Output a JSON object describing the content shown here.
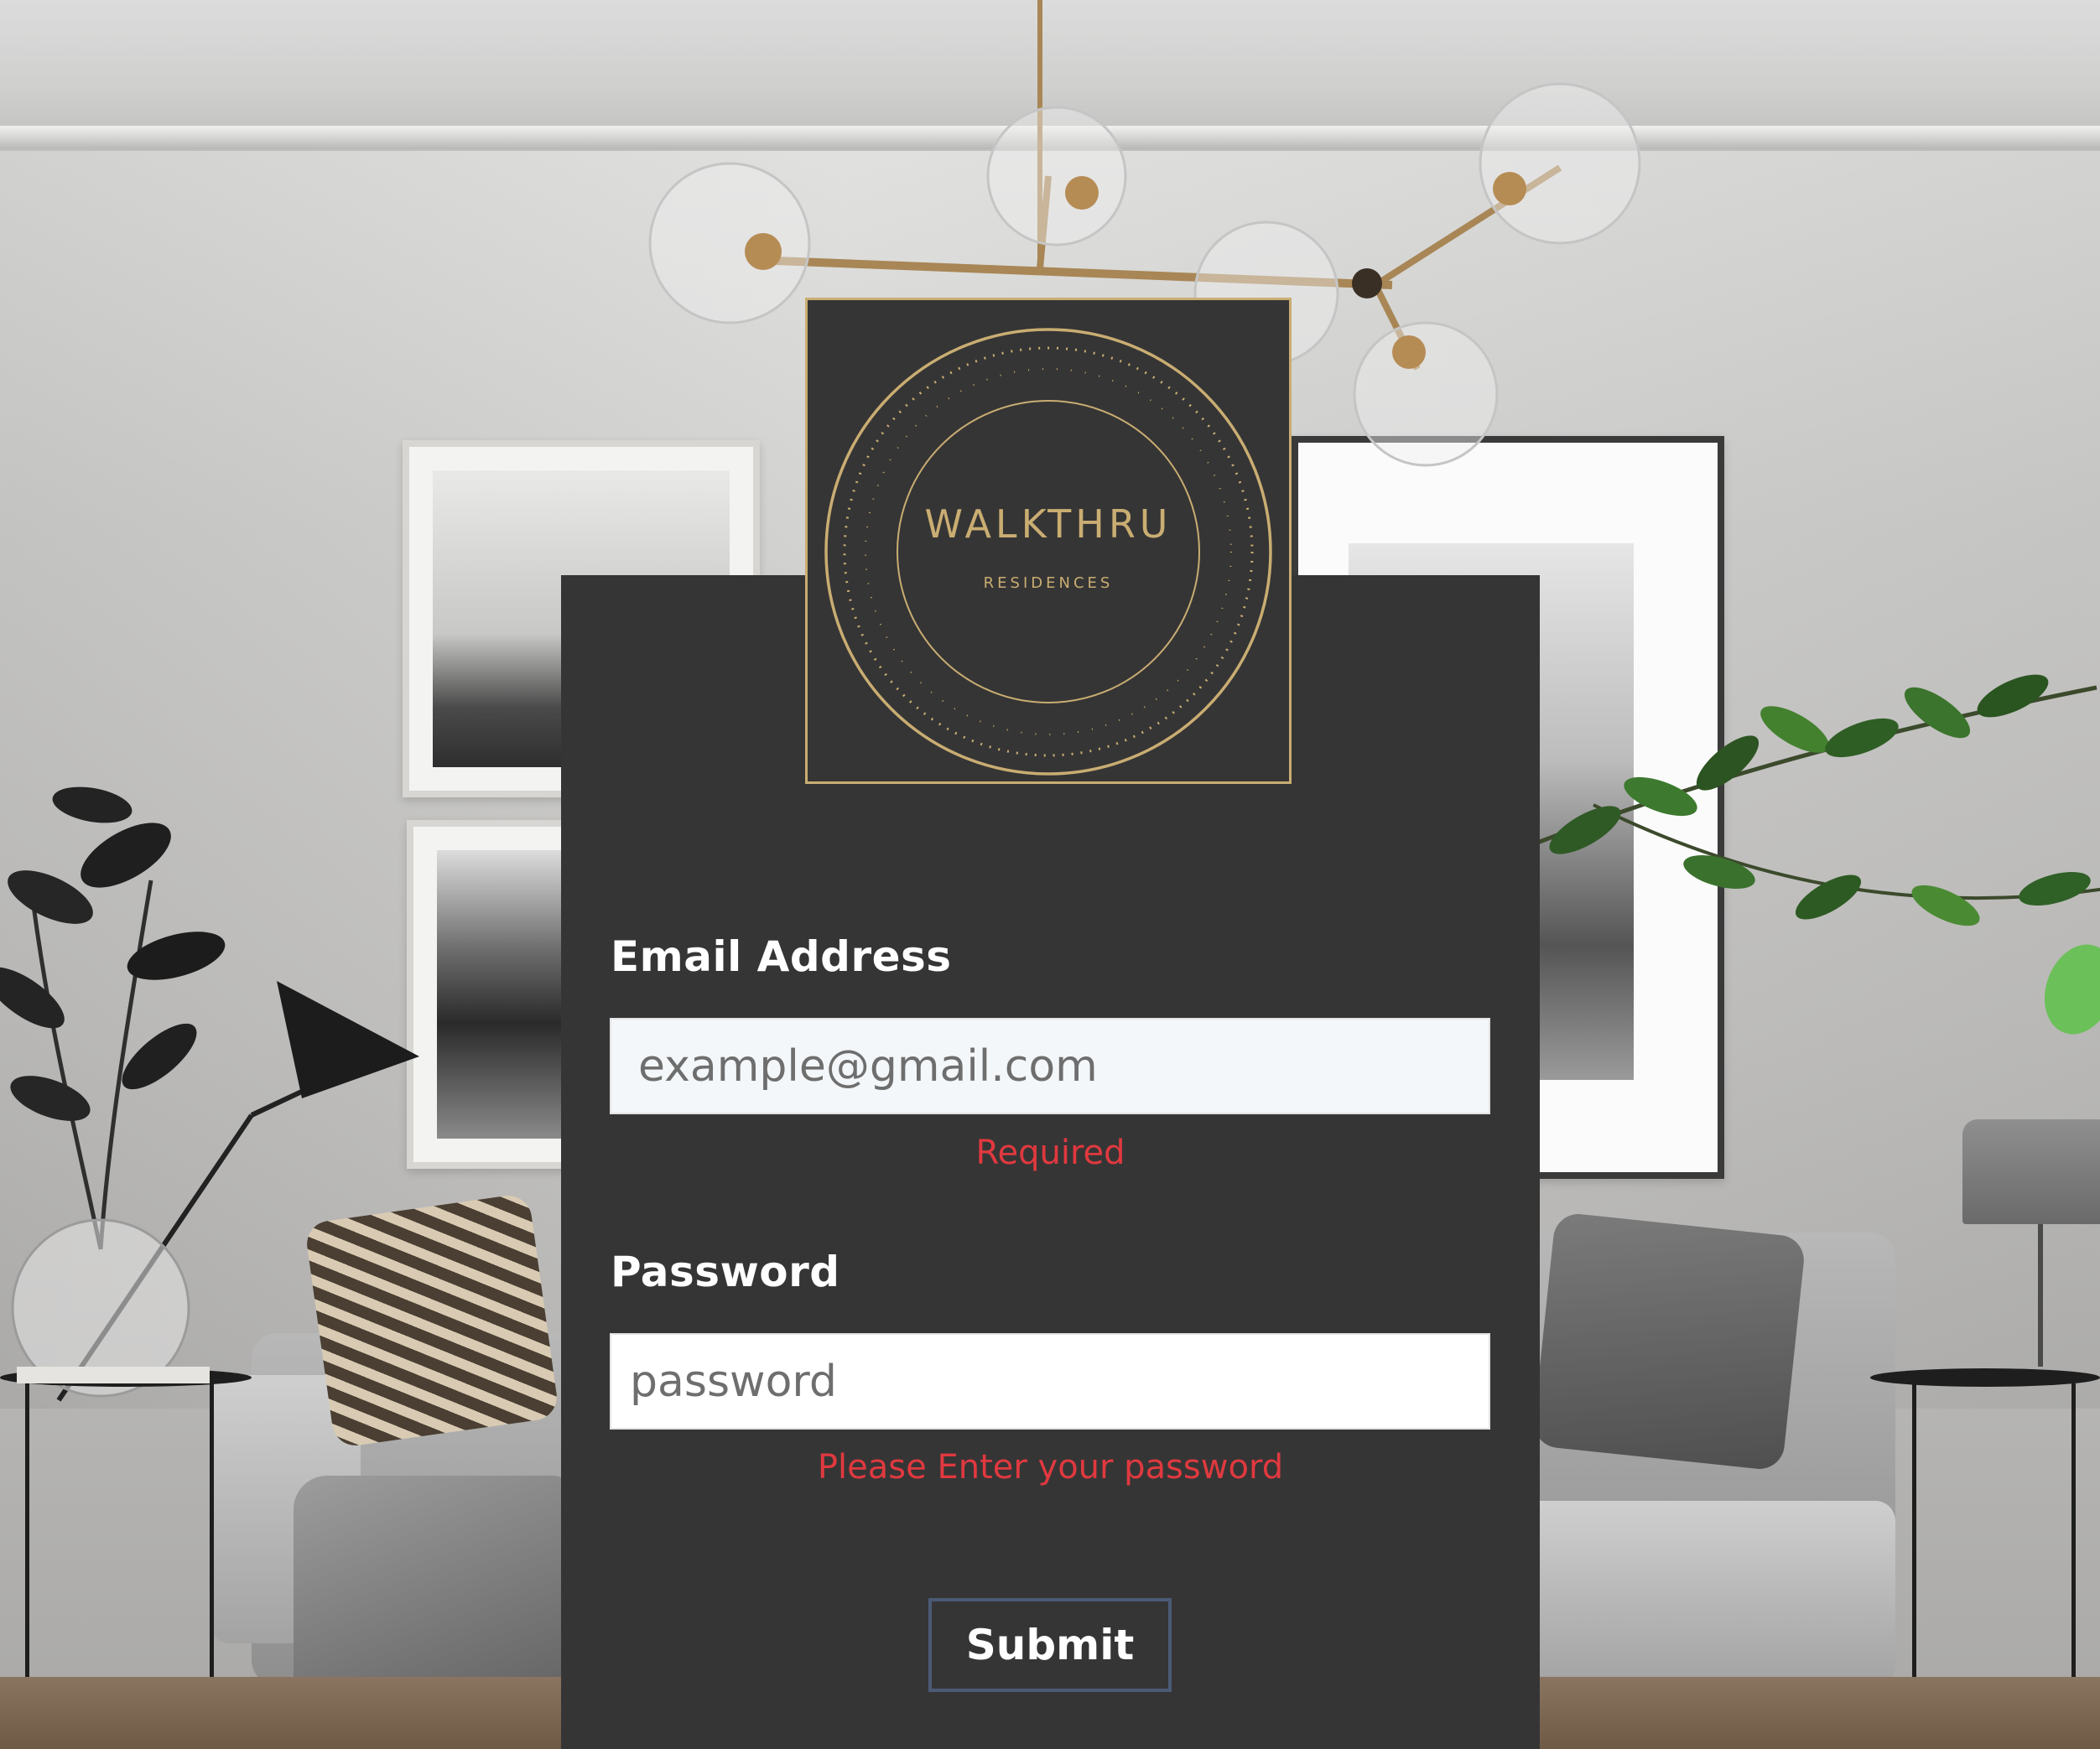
{
  "logo": {
    "brand": "WALKTHRU",
    "tagline": "RESIDENCES",
    "accent_color": "#c9ad72"
  },
  "form": {
    "email": {
      "label": "Email Address",
      "placeholder": "example@gmail.com",
      "value": "",
      "error": "Required"
    },
    "password": {
      "label": "Password",
      "placeholder": "password",
      "value": "",
      "error": "Please Enter your password"
    },
    "submit_label": "Submit"
  },
  "colors": {
    "card_background": "#363535",
    "error": "#e0393f",
    "submit_border": "#4b5a76"
  }
}
